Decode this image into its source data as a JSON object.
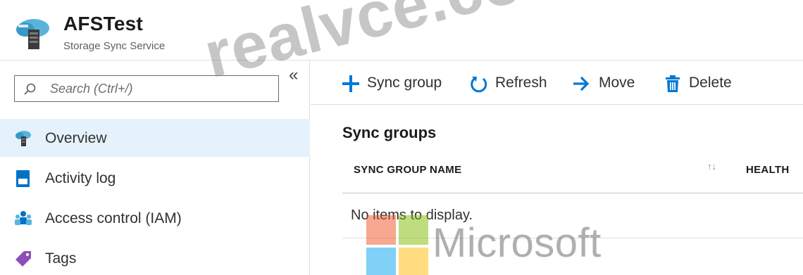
{
  "header": {
    "title": "AFSTest",
    "subtitle": "Storage Sync Service"
  },
  "search": {
    "placeholder": "Search (Ctrl+/)"
  },
  "collapse_label": "«",
  "nav": {
    "items": [
      {
        "label": "Overview",
        "icon": "storage-sync-icon",
        "selected": true
      },
      {
        "label": "Activity log",
        "icon": "activity-log-icon",
        "selected": false
      },
      {
        "label": "Access control (IAM)",
        "icon": "access-control-icon",
        "selected": false
      },
      {
        "label": "Tags",
        "icon": "tag-icon",
        "selected": false
      }
    ]
  },
  "toolbar": {
    "sync_group_label": "Sync group",
    "refresh_label": "Refresh",
    "move_label": "Move",
    "delete_label": "Delete"
  },
  "content": {
    "section_title": "Sync groups",
    "columns": [
      "SYNC GROUP NAME",
      "HEALTH"
    ],
    "sort_glyph": "↑↓",
    "empty_message": "No items to display."
  },
  "watermark": {
    "text": "realvce.com",
    "logo_word": "Microsoft"
  },
  "colors": {
    "accent": "#0078d4",
    "selected_bg": "#e6f2fb",
    "border": "#e1dfdd"
  }
}
